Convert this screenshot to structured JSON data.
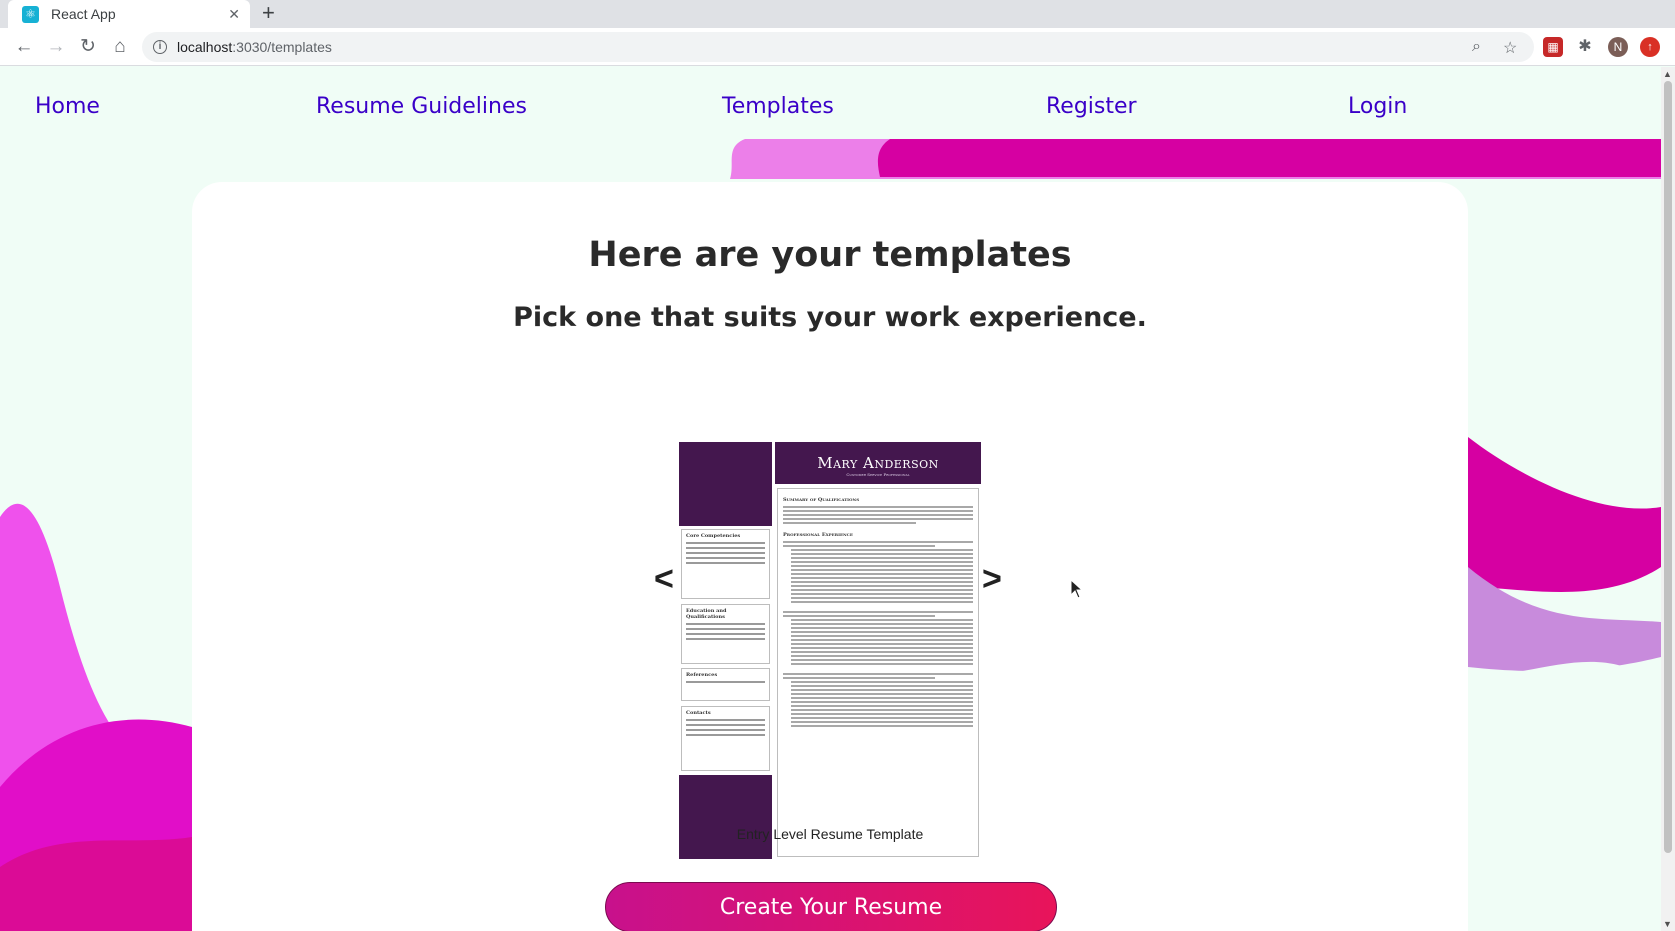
{
  "browser": {
    "tab_title": "React App",
    "tab_favicon": "react-icon",
    "tab_close": "✕",
    "new_tab": "+",
    "url_host": "localhost",
    "url_path": ":3030/templates",
    "profile_initial": "N"
  },
  "nav": {
    "home": "Home",
    "guidelines": "Resume Guidelines",
    "templates": "Templates",
    "register": "Register",
    "login": "Login"
  },
  "main": {
    "heading": "Here are your templates",
    "subheading": "Pick one that suits your work experience.",
    "prev_label": "<",
    "next_label": ">",
    "template_caption": "Entry Level Resume Template",
    "create_button": "Create Your Resume"
  },
  "preview": {
    "name": "Mary Anderson",
    "role": "Customer Service Professional",
    "side_sections": [
      "Core Competencies",
      "Education and Qualifications",
      "References",
      "Contacts"
    ],
    "main_sections": [
      "Summary of Qualifications",
      "Professional Experience"
    ]
  },
  "colors": {
    "nav_link": "#3a00c8",
    "accent_pink": "#c8118c",
    "accent_red": "#e8145a",
    "resume_purple": "#44174e",
    "page_bg": "#f0fdf6"
  }
}
